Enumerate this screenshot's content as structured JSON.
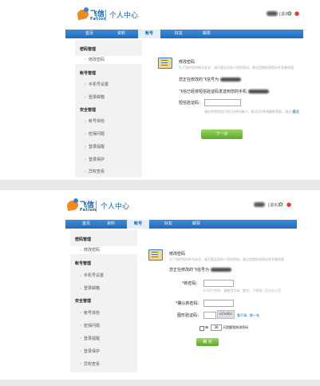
{
  "header": {
    "logo_cn": "飞信",
    "logo_en": "Fetion",
    "title": "个人中心",
    "exit": "[退出]"
  },
  "nav": [
    {
      "label": "首页"
    },
    {
      "label": "资料"
    },
    {
      "label": "帐号"
    },
    {
      "label": "好友"
    },
    {
      "label": "邮票"
    }
  ],
  "sidebar": {
    "group1": "密码管理",
    "item_change_pw": "修改密码",
    "group2": "帐号管理",
    "item_phone": "手机号设置",
    "item_login_email": "登录邮箱",
    "group3": "安全管理",
    "item_check": "帐号体检",
    "item_question": "密保问题",
    "item_remind": "登录提醒",
    "item_protect": "登录保护",
    "item_review": "异权查看"
  },
  "panel1": {
    "section_title": "修改密码",
    "note": "为了保护您的帐号安全，请不要告诉他人您的密码，建议定期修改密码并妥善保管",
    "bound_phone_text": "您正在修改的飞信号为",
    "sms_text": "飞信已经将短信验证码发送到您的手机",
    "code_label": "短信验证码：",
    "code_hint": "请在收到短信后的2分钟内输入，超过2分钟请重新获取，请点击",
    "code_link": "重发",
    "next_button": "下一步"
  },
  "panel2": {
    "section_title": "修改密码",
    "note": "为了保护您的帐号安全，请不要告诉他人您的密码，建议定期修改密码并妥善保管",
    "bound_phone_text": "您正在修改的飞信号为",
    "new_pw_label": "*新密码：",
    "new_pw_hint": "6-16个字符，请使用字母、数字、下划线，区分大小写",
    "confirm_pw_label": "*确认新密码：",
    "captcha_label": "图形验证码：",
    "captcha_text": "eDeKe",
    "captcha_link": "看不清，换一张",
    "remind_prefix": "每",
    "remind_days": "30",
    "remind_suffix": "天提醒我修改密码",
    "confirm_button": "确 定"
  }
}
